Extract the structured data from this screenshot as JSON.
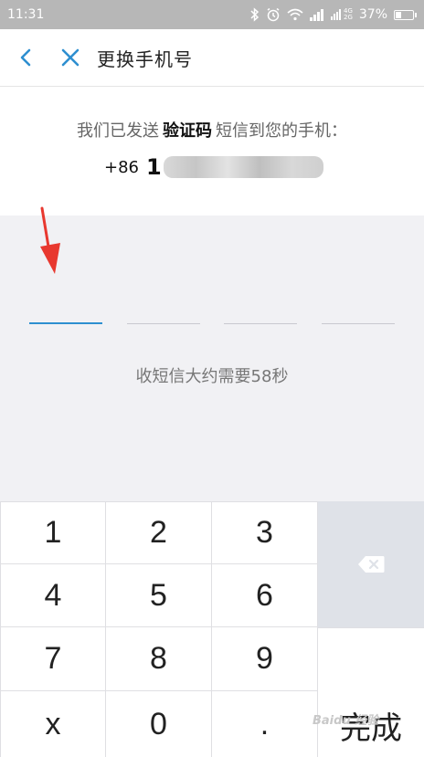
{
  "status": {
    "time": "11:31",
    "net_top": "4G",
    "net_bottom": "2G",
    "battery": "37%",
    "battery_level": 0.37
  },
  "nav": {
    "title": "更换手机号",
    "back_icon": "chevron-left-icon",
    "close_icon": "close-icon",
    "accent": "#2e8fd0"
  },
  "info": {
    "prefix": "我们已发送",
    "bold": "验证码",
    "suffix": "短信到您的手机：",
    "country_code": "+86",
    "first_digit": "1"
  },
  "code": {
    "hint": "收短信大约需要58秒",
    "accent": "#2e8fd0"
  },
  "keypad": {
    "keys": [
      "1",
      "2",
      "3",
      "4",
      "5",
      "6",
      "7",
      "8",
      "9",
      "x",
      "0",
      "."
    ],
    "done_label": "完成",
    "delete_icon": "backspace-icon"
  },
  "watermark": "Baidu 经验"
}
